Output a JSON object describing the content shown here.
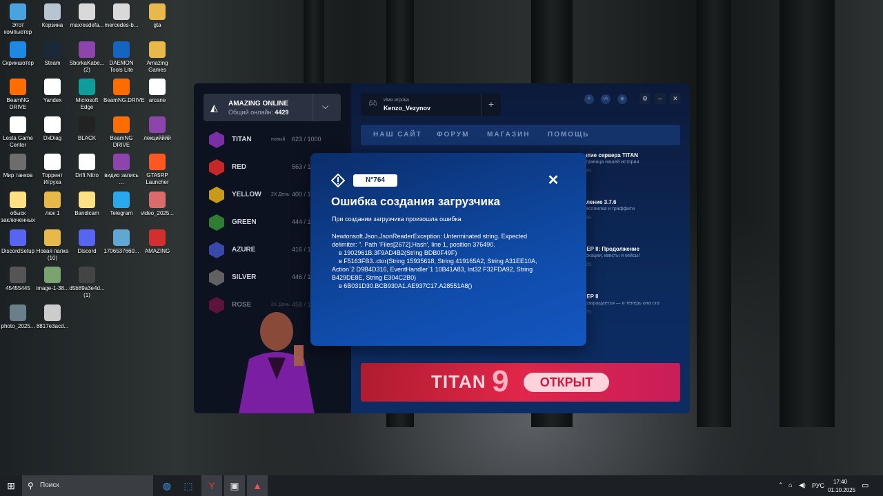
{
  "desktop": {
    "icons": [
      {
        "label": "Этот компьютер",
        "icon": "pc-icon",
        "color": "#4aa3df"
      },
      {
        "label": "Корзина",
        "icon": "recycle-bin-icon",
        "color": "#b8c4d0"
      },
      {
        "label": "maxresdefa...",
        "icon": "image-file-icon",
        "color": "#d9d9d9"
      },
      {
        "label": "mercedes-b...",
        "icon": "image-file-icon",
        "color": "#d9d9d9"
      },
      {
        "label": "gta",
        "icon": "folder-icon",
        "color": "#e8b84a"
      },
      {
        "label": "Скриншотер",
        "icon": "screenshot-icon",
        "color": "#1e88e5"
      },
      {
        "label": "Steam",
        "icon": "steam-icon",
        "color": "#1b2838"
      },
      {
        "label": "SborkaKabe... (2)",
        "icon": "archive-icon",
        "color": "#8e44ad"
      },
      {
        "label": "DAEMON Tools Lite",
        "icon": "daemon-tools-icon",
        "color": "#1565c0"
      },
      {
        "label": "Amazing Games",
        "icon": "folder-icon",
        "color": "#e8b84a"
      },
      {
        "label": "BeamNG DRIVE",
        "icon": "beamng-icon",
        "color": "#ff6d00"
      },
      {
        "label": "Yandex",
        "icon": "yandex-icon",
        "color": "#ffffff"
      },
      {
        "label": "Microsoft Edge",
        "icon": "edge-icon",
        "color": "#0f9d9a"
      },
      {
        "label": "BeamNG.DRIVE",
        "icon": "beamng-icon",
        "color": "#ff6d00"
      },
      {
        "label": "arcane",
        "icon": "yandex-icon",
        "color": "#ffffff"
      },
      {
        "label": "Lesta Game Center",
        "icon": "document-icon",
        "color": "#ffffff"
      },
      {
        "label": "DxDiag",
        "icon": "document-icon",
        "color": "#ffffff"
      },
      {
        "label": "BLACK",
        "icon": "image-file-icon",
        "color": "#222222"
      },
      {
        "label": "BeamNG DRIVE",
        "icon": "beamng-icon",
        "color": "#ff6d00"
      },
      {
        "label": "лекцийййй",
        "icon": "archive-icon",
        "color": "#8e44ad"
      },
      {
        "label": "Мир танков",
        "icon": "tanks-icon",
        "color": "#6d6d6d"
      },
      {
        "label": "Торрент Игруха",
        "icon": "document-icon",
        "color": "#ffffff"
      },
      {
        "label": "Drift Nitro",
        "icon": "yandex-icon",
        "color": "#ffffff"
      },
      {
        "label": "видио запись ...",
        "icon": "archive-icon",
        "color": "#8e44ad"
      },
      {
        "label": "GTA5RP Launcher",
        "icon": "gta5rp-icon",
        "color": "#ff5722"
      },
      {
        "label": "обыск заключенных",
        "icon": "document-icon",
        "color": "#ffe082"
      },
      {
        "label": "люк 1",
        "icon": "folder-icon",
        "color": "#e8b84a"
      },
      {
        "label": "Bandicam",
        "icon": "document-icon",
        "color": "#ffe082"
      },
      {
        "label": "Telegram",
        "icon": "telegram-icon",
        "color": "#29a9eb"
      },
      {
        "label": "video_2025...",
        "icon": "video-file-icon",
        "color": "#d96b6b"
      },
      {
        "label": "DiscordSetup",
        "icon": "discord-icon",
        "color": "#5865f2"
      },
      {
        "label": "Новая папка (10)",
        "icon": "folder-icon",
        "color": "#e8b84a"
      },
      {
        "label": "Discord",
        "icon": "discord-icon",
        "color": "#5865f2"
      },
      {
        "label": "1706537660...",
        "icon": "image-file-icon",
        "color": "#5fa8d3"
      },
      {
        "label": "AMAZING",
        "icon": "amazing-icon",
        "color": "#d32f2f"
      },
      {
        "label": "45455445",
        "icon": "image-file-icon",
        "color": "#555555"
      },
      {
        "label": "image-1-38...",
        "icon": "image-file-icon",
        "color": "#7ba36f"
      },
      {
        "label": "d5b89a3e4d... (1)",
        "icon": "image-file-icon",
        "color": "#444444"
      },
      {
        "label": "",
        "icon": "",
        "color": ""
      },
      {
        "label": "",
        "icon": "",
        "color": ""
      },
      {
        "label": "photo_2025...",
        "icon": "image-file-icon",
        "color": "#6b7f8a"
      },
      {
        "label": "8817e3acd...",
        "icon": "image-file-icon",
        "color": "#cccccc"
      }
    ]
  },
  "launcher": {
    "server_select": {
      "title": "AMAZING ONLINE",
      "online_label": "Общий онлайн:",
      "online_value": "4429"
    },
    "servers": [
      {
        "name": "TITAN",
        "tag": "новый",
        "count": "623 / 1000",
        "color": "#7b2fa6"
      },
      {
        "name": "RED",
        "tag": "",
        "count": "563 / 1",
        "color": "#c62828"
      },
      {
        "name": "YELLOW",
        "tag": "2X День",
        "count": "400 / 1",
        "color": "#c79a1a"
      },
      {
        "name": "GREEN",
        "tag": "",
        "count": "444 / 1",
        "color": "#2e7d32"
      },
      {
        "name": "AZURE",
        "tag": "",
        "count": "416 / 1",
        "color": "#3949ab"
      },
      {
        "name": "SILVER",
        "tag": "",
        "count": "446 / 1",
        "color": "#616161"
      },
      {
        "name": "ROSE",
        "tag": "2X День",
        "count": "458 / 1",
        "color": "#ad1457"
      }
    ],
    "player": {
      "label": "Имя игрока",
      "value": "Kenzo_Vezynov"
    },
    "nav": [
      "НАШ САЙТ",
      "ФОРУМ",
      "МАГАЗИН",
      "ПОМОЩЬ"
    ],
    "news": [
      {
        "title": "ытие сервера TITAN",
        "sub": "страница нашей истории",
        "date": "025"
      },
      {
        "title": "вление 3.7.6",
        "sub": "лесопилка и граффити",
        "date": "025"
      },
      {
        "title": "EEP II: Продолжение",
        "sub": "локации, квесты и кейсы!",
        "date": "025"
      },
      {
        "title": "EEP II",
        "sub": "возвращается — и теперь она ста",
        "date": "025"
      }
    ],
    "banner": {
      "title": "TITAN",
      "number": "9",
      "open": "ОТКРЫТ"
    }
  },
  "dialog": {
    "badge": "N°764",
    "title": "Ошибка создания загрузчика",
    "subtitle": "При создании загрузчика произошла ошибка",
    "details": "Newtonsoft.Json.JsonReaderException: Unterminated string. Expected\ndelimiter: \". Path 'Files[2672].Hash', line 1, position 376490.\n    в 1902961B.3F9AD4B2(String BDB0F49F)\n    в F5163FB3..ctor(String 15935618, String 419165A2, String A31EE10A,\nAction`2 D9B4D316, EventHandler`1 10B41A83, Int32 F32FDA92, String\nB429DE8E, String E304C2B0)\n    в 6B031D30.BCB930A1.AE937C17.A28551A8()"
  },
  "taskbar": {
    "search_placeholder": "Поиск",
    "lang": "РУС",
    "time": "17:40",
    "date": "01.10.2025"
  }
}
